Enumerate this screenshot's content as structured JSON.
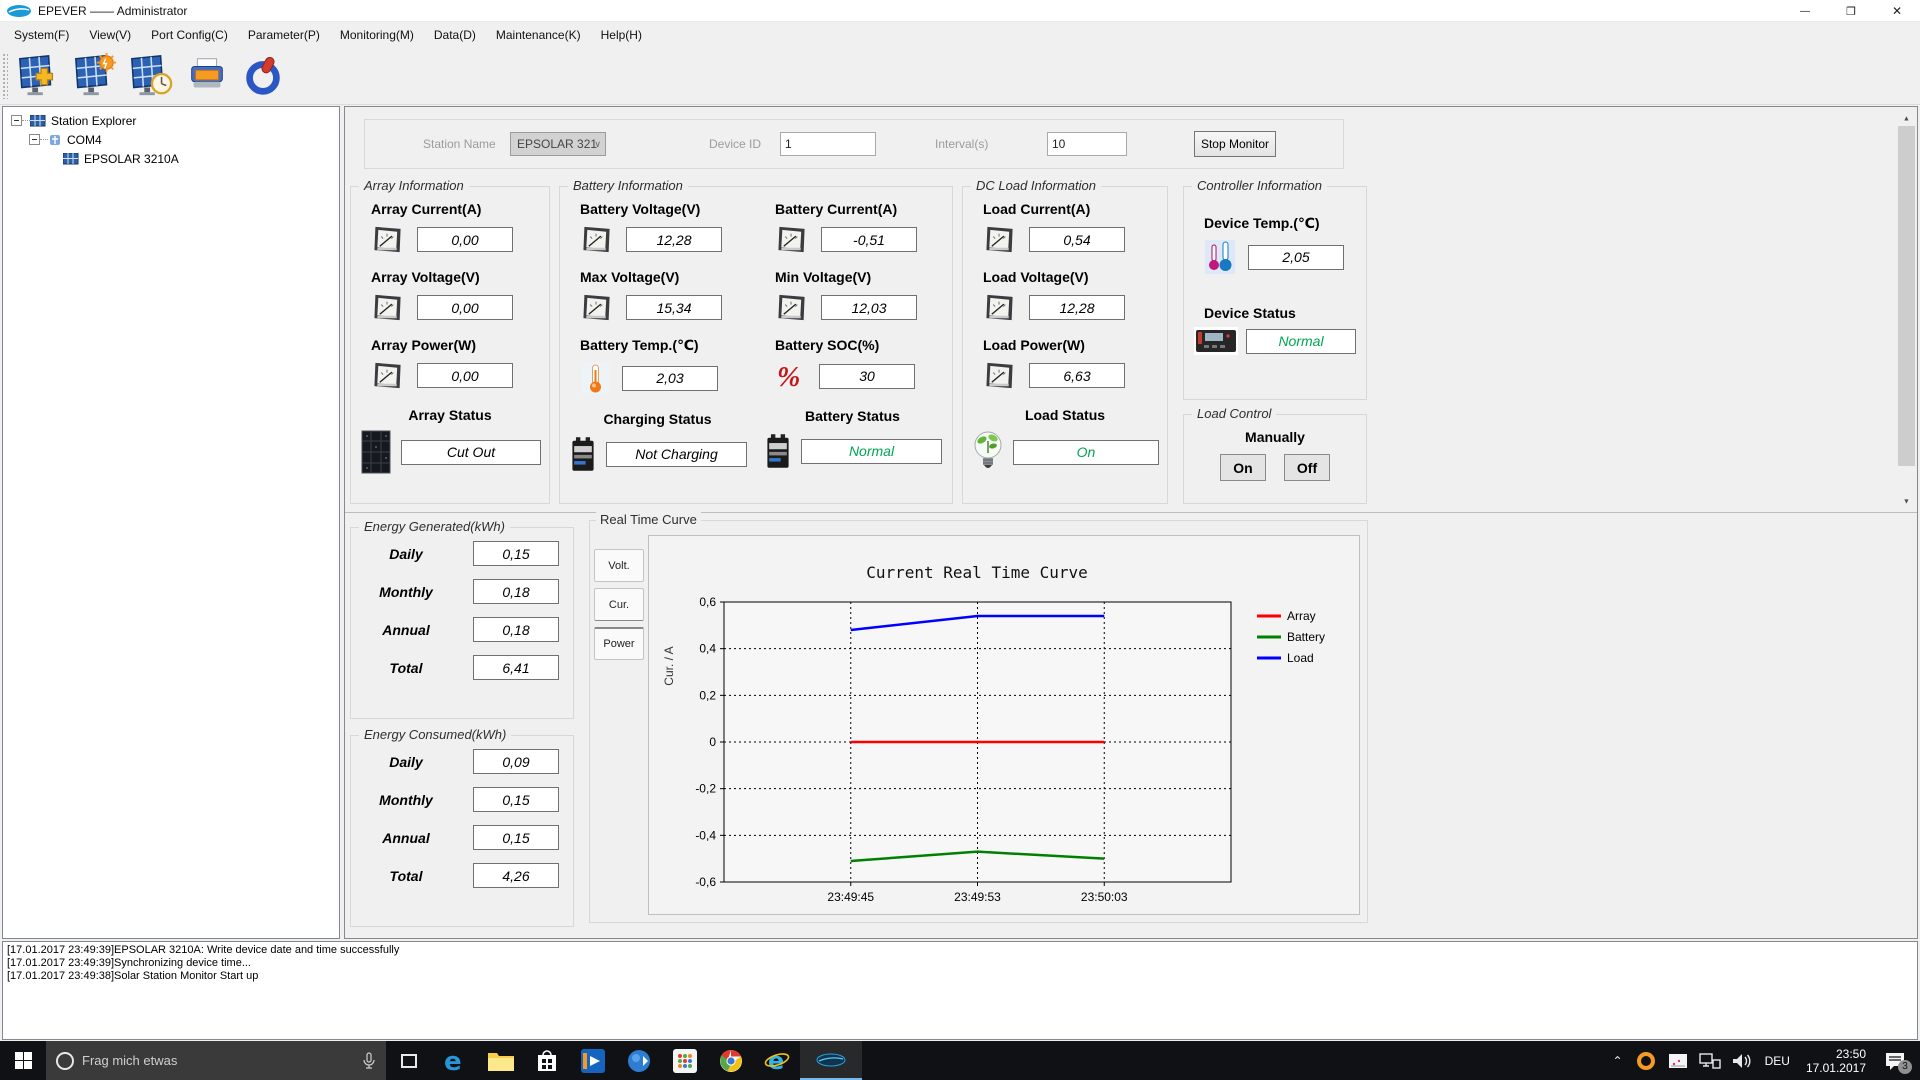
{
  "window": {
    "title": "EPEVER —— Administrator"
  },
  "menu": {
    "items": [
      "System(F)",
      "View(V)",
      "Port Config(C)",
      "Parameter(P)",
      "Monitoring(M)",
      "Data(D)",
      "Maintenance(K)",
      "Help(H)"
    ]
  },
  "tree": {
    "root": "Station Explorer",
    "port": "COM4",
    "device": "EPSOLAR 3210A"
  },
  "station_bar": {
    "station_name_label": "Station Name",
    "station_name_value": "EPSOLAR 321",
    "device_id_label": "Device ID",
    "device_id_value": "1",
    "interval_label": "Interval(s)",
    "interval_value": "10",
    "stop_button": "Stop Monitor"
  },
  "array_info": {
    "title": "Array Information",
    "metrics": [
      {
        "label": "Array Current(A)",
        "value": "0,00"
      },
      {
        "label": "Array Voltage(V)",
        "value": "0,00"
      },
      {
        "label": "Array Power(W)",
        "value": "0,00"
      }
    ],
    "status_label": "Array Status",
    "status_value": "Cut Out"
  },
  "battery_info": {
    "title": "Battery Information",
    "col1": [
      {
        "label": "Battery Voltage(V)",
        "value": "12,28"
      },
      {
        "label": "Max Voltage(V)",
        "value": "15,34"
      },
      {
        "label": "Battery Temp.(℃)",
        "value": "2,03"
      }
    ],
    "col2": [
      {
        "label": "Battery Current(A)",
        "value": "-0,51"
      },
      {
        "label": "Min Voltage(V)",
        "value": "12,03"
      },
      {
        "label": "Battery SOC(%)",
        "value": "30"
      }
    ],
    "charging_status_label": "Charging Status",
    "charging_status_value": "Not Charging",
    "battery_status_label": "Battery Status",
    "battery_status_value": "Normal"
  },
  "dc_load": {
    "title": "DC Load Information",
    "metrics": [
      {
        "label": "Load Current(A)",
        "value": "0,54"
      },
      {
        "label": "Load Voltage(V)",
        "value": "12,28"
      },
      {
        "label": "Load Power(W)",
        "value": "6,63"
      }
    ],
    "status_label": "Load Status",
    "status_value": "On"
  },
  "controller": {
    "title": "Controller Information",
    "temp_label": "Device Temp.(℃)",
    "temp_value": "2,05",
    "status_label": "Device Status",
    "status_value": "Normal"
  },
  "load_control": {
    "title": "Load Control",
    "mode_label": "Manually",
    "on_button": "On",
    "off_button": "Off"
  },
  "energy_generated": {
    "title": "Energy Generated(kWh)",
    "rows": [
      {
        "label": "Daily",
        "value": "0,15"
      },
      {
        "label": "Monthly",
        "value": "0,18"
      },
      {
        "label": "Annual",
        "value": "0,18"
      },
      {
        "label": "Total",
        "value": "6,41"
      }
    ]
  },
  "energy_consumed": {
    "title": "Energy Consumed(kWh)",
    "rows": [
      {
        "label": "Daily",
        "value": "0,09"
      },
      {
        "label": "Monthly",
        "value": "0,15"
      },
      {
        "label": "Annual",
        "value": "0,15"
      },
      {
        "label": "Total",
        "value": "4,26"
      }
    ]
  },
  "curve": {
    "group_title": "Real Time Curve",
    "tabs": [
      "Volt.",
      "Cur.",
      "Power"
    ]
  },
  "chart_data": {
    "type": "line",
    "title": "Current Real Time Curve",
    "ylabel": "Cur. / A",
    "x": [
      "23:49:45",
      "23:49:53",
      "23:50:03"
    ],
    "series": [
      {
        "name": "Array",
        "color": "#ff0000",
        "values": [
          0,
          0,
          0
        ]
      },
      {
        "name": "Battery",
        "color": "#008000",
        "values": [
          -0.51,
          -0.47,
          -0.5
        ]
      },
      {
        "name": "Load",
        "color": "#0000ff",
        "values": [
          0.48,
          0.54,
          0.54
        ]
      }
    ],
    "ylim": [
      -0.6,
      0.6
    ],
    "yticks": [
      {
        "v": 0.6,
        "label": "0,6"
      },
      {
        "v": 0.4,
        "label": "0,4"
      },
      {
        "v": 0.2,
        "label": "0,2"
      },
      {
        "v": 0.0,
        "label": "0"
      },
      {
        "v": -0.2,
        "label": "-0,2"
      },
      {
        "v": -0.4,
        "label": "-0,4"
      },
      {
        "v": -0.6,
        "label": "-0,6"
      }
    ],
    "grid": true,
    "legend_position": "right-top"
  },
  "log": {
    "lines": [
      "[17.01.2017 23:49:39]EPSOLAR 3210A: Write device date and time successfully",
      "[17.01.2017 23:49:39]Synchronizing device time...",
      "[17.01.2017 23:49:38]Solar Station Monitor Start up"
    ]
  },
  "taskbar": {
    "search_placeholder": "Frag mich etwas",
    "language": "DEU",
    "time": "23:50",
    "date": "17.01.2017",
    "notification_count": "3"
  }
}
